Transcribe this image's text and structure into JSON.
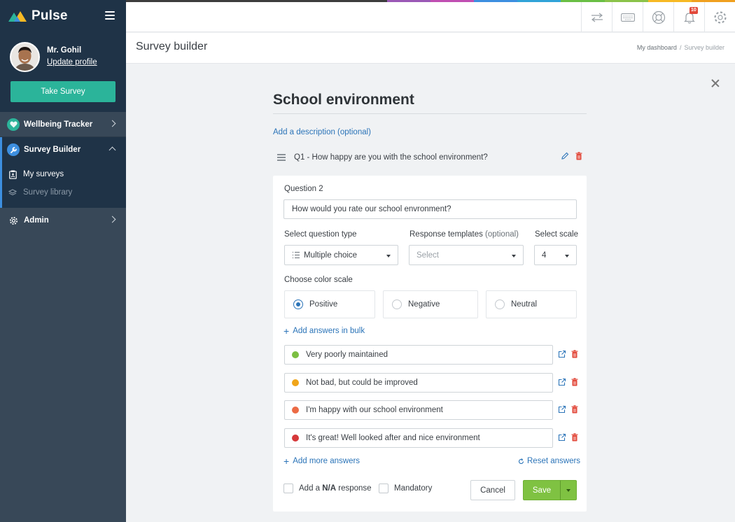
{
  "app": {
    "name": "Pulse",
    "rainbow": [
      "#3d3d3d",
      "#3d3d3d",
      "#3d3d3d",
      "#3d3d3d",
      "#3d3d3d",
      "#3d3d3d",
      "#9b59b6",
      "#c04fb2",
      "#3d8fe0",
      "#31a3d8",
      "#6abf45",
      "#8bc34a",
      "#f7b924",
      "#f0a020"
    ]
  },
  "profile": {
    "name": "Mr. Gohil",
    "update_link": "Update profile",
    "take_survey": "Take Survey"
  },
  "sidebar": {
    "wellbeing": "Wellbeing Tracker",
    "builder": "Survey Builder",
    "sub_items": [
      "My surveys",
      "Survey library"
    ],
    "admin": "Admin",
    "accent": "#3d8fe0"
  },
  "topbar": {
    "notification_count": "10"
  },
  "header": {
    "title": "Survey builder",
    "breadcrumb": [
      "My dashboard",
      "/",
      "Survey builder"
    ]
  },
  "survey": {
    "title": "School environment",
    "add_description": "Add a description (optional)",
    "q1": "Q1 - How happy are you with the school environment?",
    "question_label": "Question 2",
    "question_value": "How would you rate our school envronment?",
    "type_label": "Select question type",
    "type_value": "Multiple choice",
    "templates_label": "Response templates",
    "templates_optional": "(optional)",
    "templates_placeholder": "Select",
    "scale_label": "Select scale",
    "scale_value": "4",
    "color_scale_label": "Choose color scale",
    "color_options": [
      "Positive",
      "Negative",
      "Neutral"
    ],
    "selected_color": "Positive",
    "add_bulk": "Add answers in bulk",
    "answers": [
      {
        "text": "Very poorly maintained",
        "color": "#7cbf42"
      },
      {
        "text": "Not bad, but could be improved",
        "color": "#f0a51a"
      },
      {
        "text": "I'm happy with our school environment",
        "color": "#ec6b45"
      },
      {
        "text": "It's great! Well looked after and nice environment",
        "color": "#d6383a"
      }
    ],
    "add_more": "Add more answers",
    "reset": "Reset answers",
    "na_prefix": "Add a ",
    "na_bold": "N/A",
    "na_suffix": " response",
    "mandatory": "Mandatory",
    "cancel": "Cancel",
    "save": "Save"
  }
}
